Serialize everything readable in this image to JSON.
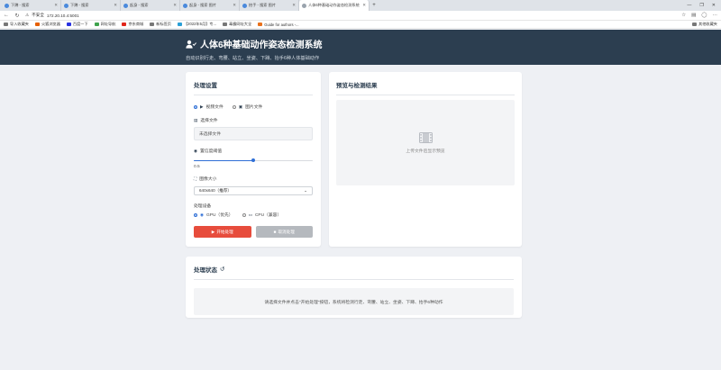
{
  "browser": {
    "tabs": [
      {
        "label": "下蹲 - 搜索",
        "active": false
      },
      {
        "label": "下蹲 - 搜索",
        "active": false
      },
      {
        "label": "起身 - 搜索",
        "active": false
      },
      {
        "label": "起身 - 搜索 图片",
        "active": false
      },
      {
        "label": "抬手 - 搜索 图片",
        "active": false
      },
      {
        "label": "人体6种基础动作姿态检测系统",
        "active": true
      }
    ],
    "new_tab": "+",
    "window_controls": [
      "—",
      "❐",
      "✕"
    ],
    "security": "不安全",
    "url": "172.20.10.4:5001",
    "bookmarks": [
      "导入收藏夹",
      "火狐浏览器",
      "百度一下",
      "网址导航",
      "京东商城",
      "新标签页",
      "【2022年5月】专...",
      "毒霸网址大全",
      "Guide for authors -..."
    ],
    "other_bookmarks": "其他收藏夹"
  },
  "header": {
    "title": "人体6种基础动作姿态检测系统",
    "subtitle": "自动识别行走、弯腰、站立、坐姿、下蹲、抬手6种人体基础动作"
  },
  "settings": {
    "title": "处理设置",
    "mode_video": "视频文件",
    "mode_image": "图片文件",
    "select_file_label": "选择文件",
    "file_placeholder": "未选择文件",
    "threshold_label": "置信度阈值",
    "threshold_value": "0.5",
    "threshold_fraction": 0.5,
    "image_size_label": "图像大小",
    "image_size_value": "640x640（推荐）",
    "device_label": "处理设备",
    "device_gpu": "GPU（优先）",
    "device_cpu": "CPU（兼容）",
    "start_button": "开始处理",
    "stop_button": "取消处理"
  },
  "preview": {
    "title": "预览与检测结果",
    "placeholder": "上传文件后显示预览"
  },
  "status": {
    "title": "处理状态",
    "message": "请选择文件并点击\"开始处理\"按钮，系统将检测行走、弯腰、站立、坐姿、下蹲、抬手6种动作"
  },
  "colors": {
    "header_bg": "#2c3e50",
    "accent": "#2f6fd6",
    "start_button": "#e74c3c",
    "stop_button": "#b5b9be"
  }
}
